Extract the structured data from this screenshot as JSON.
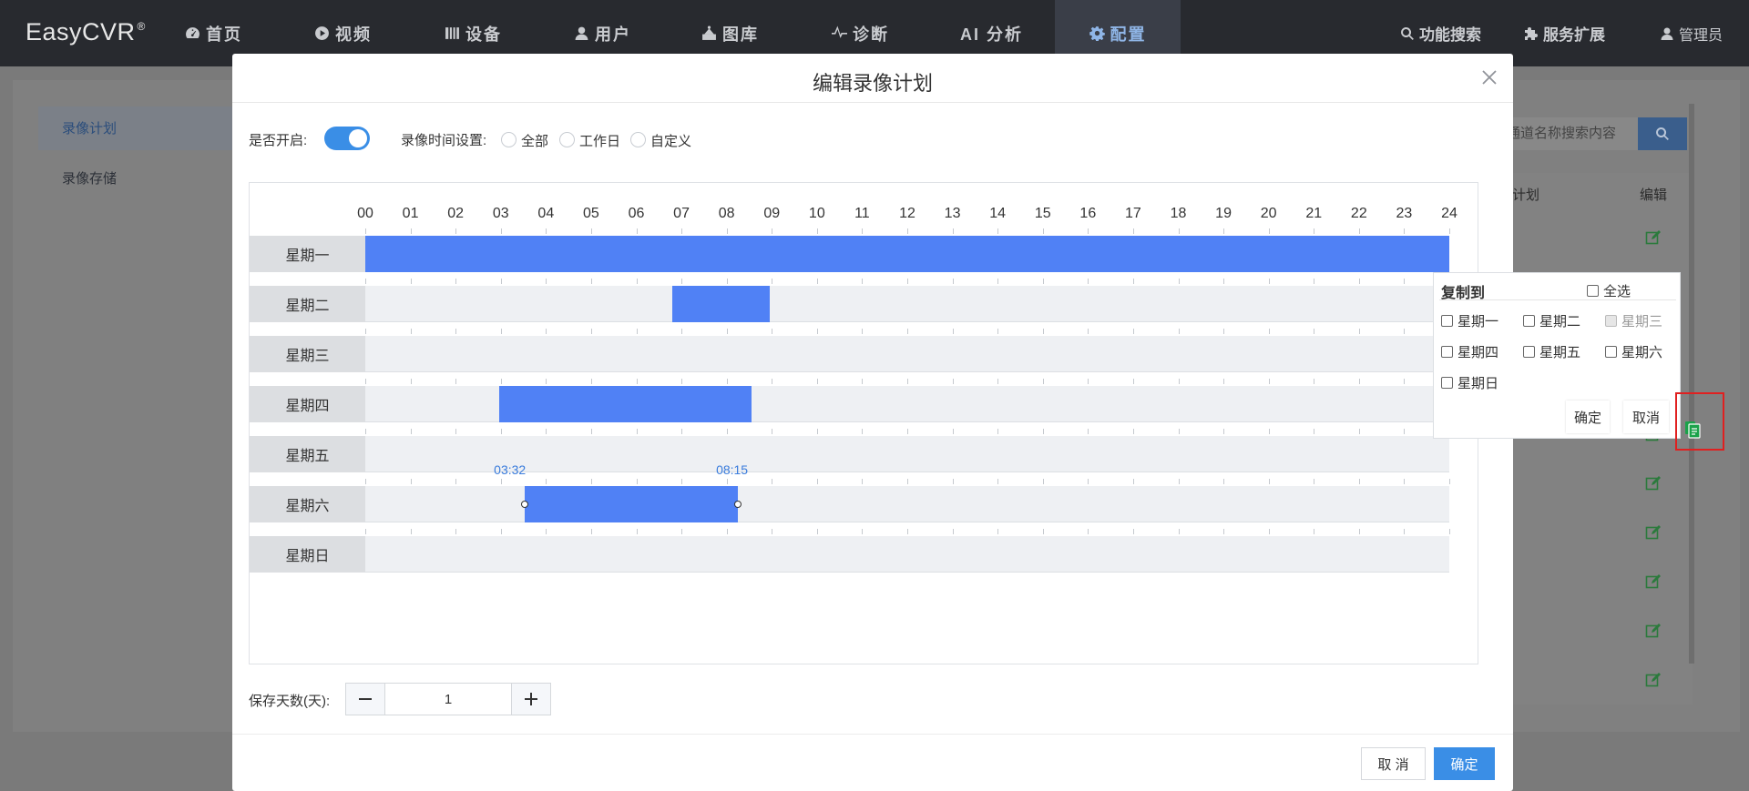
{
  "app": {
    "name": "EasyCVR"
  },
  "nav": [
    {
      "label": "首页",
      "icon": "dashboard-icon"
    },
    {
      "label": "视频",
      "icon": "play-icon"
    },
    {
      "label": "设备",
      "icon": "device-icon"
    },
    {
      "label": "用户",
      "icon": "user-icon"
    },
    {
      "label": "图库",
      "icon": "gallery-icon"
    },
    {
      "label": "诊断",
      "icon": "pulse-icon"
    },
    {
      "label": "AI 分析",
      "icon": ""
    },
    {
      "label": "配置",
      "icon": "gear-icon",
      "active": true
    }
  ],
  "right_nav": {
    "search": "功能搜索",
    "extend": "服务扩展",
    "user": "管理员"
  },
  "sidebar": {
    "items": [
      {
        "label": "录像计划",
        "active": true
      },
      {
        "label": "录像存储",
        "active": false
      }
    ]
  },
  "background": {
    "search_placeholder": "通道名称搜索内容",
    "col_plan": "计划",
    "col_edit": "编辑",
    "edit_rows": 10
  },
  "modal": {
    "title": "编辑录像计划",
    "enable_label": "是否开启:",
    "enabled": true,
    "time_setting_label": "录像时间设置:",
    "time_options": [
      "全部",
      "工作日",
      "自定义"
    ],
    "hours": [
      "00",
      "01",
      "02",
      "03",
      "04",
      "05",
      "06",
      "07",
      "08",
      "09",
      "10",
      "11",
      "12",
      "13",
      "14",
      "15",
      "16",
      "17",
      "18",
      "19",
      "20",
      "21",
      "22",
      "23",
      "24"
    ],
    "days": [
      {
        "label": "星期一",
        "segments": [
          [
            0,
            24
          ]
        ]
      },
      {
        "label": "星期二",
        "segments": [
          [
            6.8,
            8.95
          ]
        ]
      },
      {
        "label": "星期三",
        "segments": []
      },
      {
        "label": "星期四",
        "segments": [
          [
            2.97,
            8.55
          ]
        ]
      },
      {
        "label": "星期五",
        "segments": []
      },
      {
        "label": "星期六",
        "segments": [
          [
            3.533,
            8.25
          ]
        ],
        "start_label": "03:32",
        "end_label": "08:15"
      },
      {
        "label": "星期日",
        "segments": []
      }
    ],
    "copy_popup": {
      "title": "复制到",
      "select_all": "全选",
      "days": [
        {
          "label": "星期一",
          "disabled": false
        },
        {
          "label": "星期二",
          "disabled": false
        },
        {
          "label": "星期三",
          "disabled": true
        },
        {
          "label": "星期四",
          "disabled": false
        },
        {
          "label": "星期五",
          "disabled": false
        },
        {
          "label": "星期六",
          "disabled": false
        },
        {
          "label": "星期日",
          "disabled": false
        }
      ],
      "confirm": "确定",
      "cancel": "取消"
    },
    "retention_label": "保存天数(天):",
    "retention_value": "1",
    "footer": {
      "cancel": "取 消",
      "confirm": "确定"
    }
  },
  "colors": {
    "accent": "#3a8ee6",
    "bar": "#5081f5",
    "highlight": "#e02020",
    "copy_icon": "#1aa24a"
  }
}
